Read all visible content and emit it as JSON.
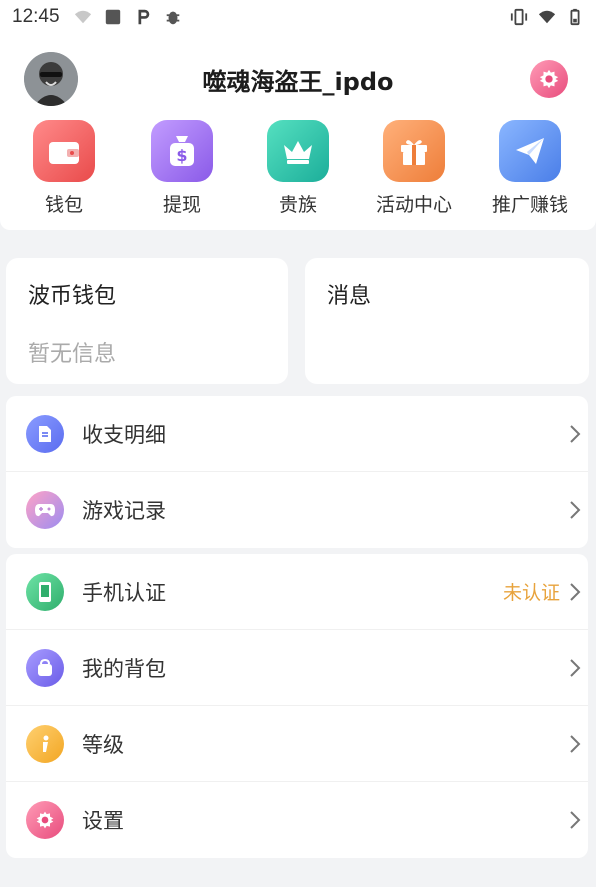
{
  "status_bar": {
    "time": "12:45",
    "left_icons": [
      "wifi-question-icon",
      "square-icon",
      "p-icon",
      "bug-icon"
    ],
    "right_icons": [
      "vibrate-icon",
      "wifi-off-icon",
      "battery-icon"
    ]
  },
  "header": {
    "username": "噬魂海盗王_ipdo",
    "avatar": "avatar",
    "settings_icon": "gear-icon"
  },
  "quick_actions": [
    {
      "label": "钱包",
      "icon": "wallet-icon",
      "color": "#ef5a5a"
    },
    {
      "label": "提现",
      "icon": "money-bag-icon",
      "color": "#9b6cf0"
    },
    {
      "label": "贵族",
      "icon": "crown-icon",
      "color": "#2ec7a8"
    },
    {
      "label": "活动中心",
      "icon": "gift-icon",
      "color": "#f59a4a"
    },
    {
      "label": "推广赚钱",
      "icon": "paper-plane-icon",
      "color": "#5a8cf0"
    }
  ],
  "wallet_card": {
    "title": "波币钱包",
    "subtitle": "暂无信息"
  },
  "message_card": {
    "title": "消息"
  },
  "group1": [
    {
      "label": "收支明细",
      "icon": "document-icon",
      "color": "#5a6cf0"
    },
    {
      "label": "游戏记录",
      "icon": "gamepad-icon",
      "color": "#f07aa8"
    }
  ],
  "group2": [
    {
      "label": "手机认证",
      "icon": "phone-icon",
      "color": "#3bbf7c",
      "status": "未认证"
    },
    {
      "label": "我的背包",
      "icon": "bag-icon",
      "color": "#7a6cf0"
    },
    {
      "label": "等级",
      "icon": "info-icon",
      "color": "#f2a623"
    },
    {
      "label": "设置",
      "icon": "gear-icon",
      "color": "#f06a94"
    }
  ]
}
